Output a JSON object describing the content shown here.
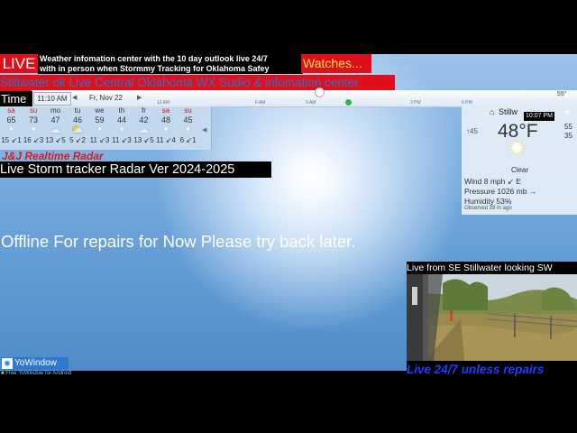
{
  "overlay": {
    "live_label": "LIVE",
    "info_line1": "Weather infomation center with the 10 day outlook live 24/7",
    "info_line2": "with in person when Stormmy Tracking for Oklahoma  Safey",
    "watches_label": "Watches...",
    "banner": "Stillwater ok Live Central Oklahoma WX Sudio & infomation center",
    "time_label": "Time",
    "radar_title": "J&J Realtime Radar",
    "storm_tracker": "Live Storm tracker Radar Ver 2024-2025",
    "offline_message": "Offline For repairs for Now Please try back later."
  },
  "timebar": {
    "clock": "11:10 AM",
    "date": "Fr, Nov 22",
    "hour_ticks": [
      "12 AM",
      "6 AM",
      "9 AM",
      "3 PM",
      "6 PM"
    ],
    "temp_marker": "55°"
  },
  "forecast": [
    {
      "day": "sa",
      "hi": "65",
      "icon": "sun-icon",
      "glyph": "☀",
      "wind": "15",
      "lo": "1"
    },
    {
      "day": "su",
      "hi": "73",
      "icon": "sun-icon",
      "glyph": "☀",
      "wind": "16",
      "lo": "3"
    },
    {
      "day": "mo",
      "hi": "47",
      "icon": "cloud-icon",
      "glyph": "☁",
      "wind": "13",
      "lo": "5"
    },
    {
      "day": "tu",
      "hi": "46",
      "icon": "partly-cloudy-icon",
      "glyph": "⛅",
      "wind": "5",
      "lo": "2"
    },
    {
      "day": "we",
      "hi": "59",
      "icon": "sun-icon",
      "glyph": "☀",
      "wind": "11",
      "lo": "3"
    },
    {
      "day": "th",
      "hi": "44",
      "icon": "sun-icon",
      "glyph": "☀",
      "wind": "11",
      "lo": "3"
    },
    {
      "day": "fr",
      "hi": "42",
      "icon": "cloud-icon",
      "glyph": "☁",
      "wind": "13",
      "lo": "5"
    },
    {
      "day": "sa",
      "hi": "48",
      "icon": "sun-icon",
      "glyph": "☀",
      "wind": "11",
      "lo": "4"
    },
    {
      "day": "su",
      "hi": "45",
      "icon": "sun-icon",
      "glyph": "☀",
      "wind": "6",
      "lo": "1"
    }
  ],
  "current": {
    "city": "Stillw",
    "time": "10:07 PM",
    "low_marker": "45",
    "temperature": "48°F",
    "high": "55",
    "low": "35",
    "condition": "Clear",
    "wind": "Wind  8 mph ↙ E",
    "pressure": "Pressure  1026 mb →",
    "humidity": "Humidity  53%",
    "observed": "Observed 39 m ago"
  },
  "branding": {
    "yowindow": "YoWindow",
    "free_line": "Free YoWindow for Android"
  },
  "camera": {
    "heading": "Live from SE Stillwater looking SW",
    "footer": "Live 24/7 unless repairs"
  }
}
